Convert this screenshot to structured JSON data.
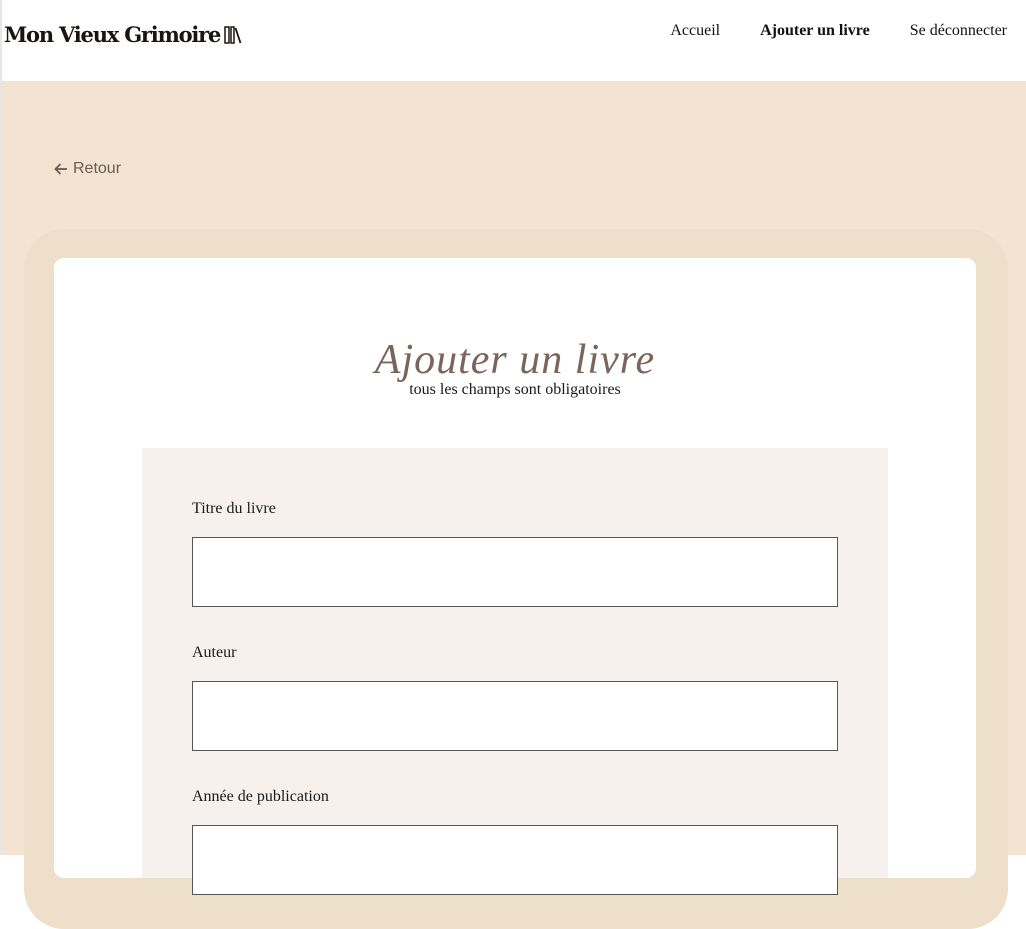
{
  "header": {
    "logo_text": "Mon Vieux Grimoire",
    "nav": [
      {
        "label": "Accueil",
        "active": false
      },
      {
        "label": "Ajouter un livre",
        "active": true
      },
      {
        "label": "Se déconnecter",
        "active": false
      }
    ]
  },
  "back_link": {
    "label": "Retour",
    "icon": "arrow-left-icon"
  },
  "card": {
    "title": "Ajouter un livre",
    "subtitle": "tous les champs sont obligatoires"
  },
  "form": {
    "fields": [
      {
        "label": "Titre du livre",
        "value": ""
      },
      {
        "label": "Auteur",
        "value": ""
      },
      {
        "label": "Année de publication",
        "value": ""
      }
    ]
  },
  "colors": {
    "page_background": "#f2e4d0",
    "title_color": "#7b6459",
    "form_background": "#f6f1ed"
  }
}
